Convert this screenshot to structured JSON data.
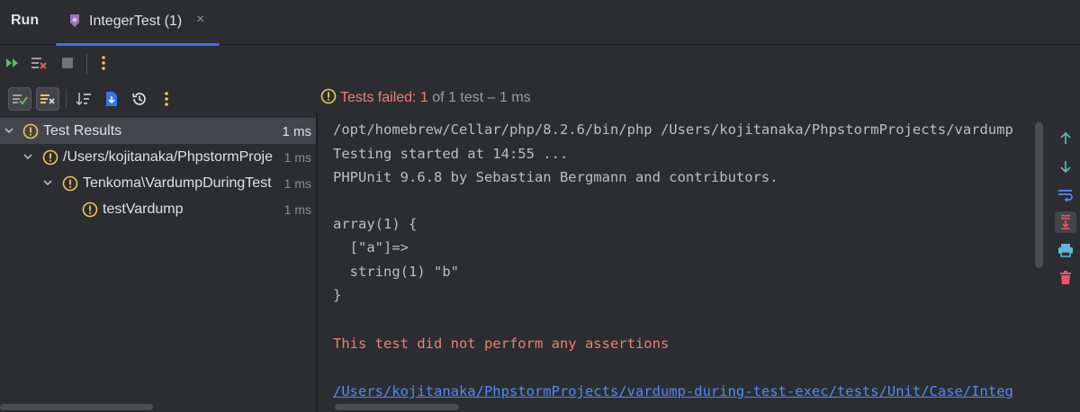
{
  "window": {
    "run_label": "Run",
    "tab_label": "IntegerTest (1)",
    "tab_close": "×"
  },
  "status": {
    "failed_text": "Tests failed: 1",
    "rest_text": " of 1 test – 1 ms"
  },
  "tree": {
    "rows": [
      {
        "label": "Test Results",
        "time": "1 ms"
      },
      {
        "label": "/Users/kojitanaka/PhpstormProje",
        "time": "1 ms"
      },
      {
        "label": "Tenkoma\\VardumpDuringTest",
        "time": "1 ms"
      },
      {
        "label": "testVardump",
        "time": "1 ms"
      }
    ]
  },
  "console": {
    "lines": [
      "/opt/homebrew/Cellar/php/8.2.6/bin/php /Users/kojitanaka/PhpstormProjects/vardump",
      "Testing started at 14:55 ...",
      "PHPUnit 9.6.8 by Sebastian Bergmann and contributors.",
      "array(1) {",
      "  [\"a\"]=>",
      "  string(1) \"b\"",
      "}",
      "This test did not perform any assertions",
      "/Users/kojitanaka/PhpstormProjects/vardump-during-test-exec/tests/Unit/Case/Integ"
    ]
  },
  "icons": {
    "rerun": "rerun-icon",
    "rerun_failed": "rerun-failed-icon",
    "stop": "stop-icon",
    "more": "more-vertical-icon",
    "show_passed": "show-passed-icon",
    "show_ignored": "show-ignored-icon",
    "sort": "sort-icon",
    "import": "import-tests-icon",
    "history": "history-icon",
    "warning": "warning-icon",
    "up": "arrow-up-icon",
    "down": "arrow-down-icon",
    "wrap": "soft-wrap-icon",
    "scroll_end": "scroll-to-end-icon",
    "print": "print-icon",
    "trash": "trash-icon"
  },
  "colors": {
    "background": "#2b2d30",
    "accent": "#3574f0",
    "warning": "#f2c55c",
    "error_text": "#f07e75",
    "link": "#548af7",
    "run_green": "#5fb865",
    "delete_red": "#e55765"
  }
}
